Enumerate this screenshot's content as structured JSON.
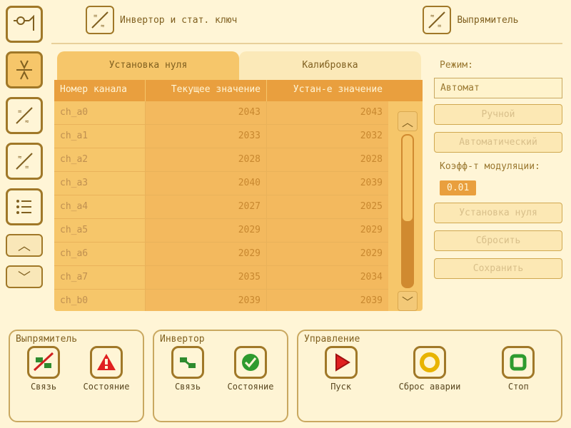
{
  "modes": {
    "inverter": "Инвертор и стат. ключ",
    "rectifier": "Выпрямитель"
  },
  "tabs": {
    "zero": "Установка нуля",
    "calib": "Калибровка"
  },
  "table": {
    "headers": {
      "ch": "Номер канала",
      "cur": "Текущее значение",
      "set": "Устан-е значение"
    },
    "rows": [
      {
        "ch": "ch_a0",
        "cur": "2043",
        "set": "2043"
      },
      {
        "ch": "ch_a1",
        "cur": "2033",
        "set": "2032"
      },
      {
        "ch": "ch_a2",
        "cur": "2028",
        "set": "2028"
      },
      {
        "ch": "ch_a3",
        "cur": "2040",
        "set": "2039"
      },
      {
        "ch": "ch_a4",
        "cur": "2027",
        "set": "2025"
      },
      {
        "ch": "ch_a5",
        "cur": "2029",
        "set": "2029"
      },
      {
        "ch": "ch_a6",
        "cur": "2029",
        "set": "2029"
      },
      {
        "ch": "ch_a7",
        "cur": "2035",
        "set": "2034"
      },
      {
        "ch": "ch_b0",
        "cur": "2039",
        "set": "2039"
      }
    ]
  },
  "right": {
    "mode_label": "Режим:",
    "mode_value": "Автомат",
    "btn_manual": "Ручной",
    "btn_auto": "Автоматический",
    "coef_label": "Коэфф-т модуляции:",
    "coef_value": "0.01",
    "btn_setzero": "Установка нуля",
    "btn_reset": "Сбросить",
    "btn_save": "Сохранить"
  },
  "status": {
    "rect": {
      "title": "Выпрямитель",
      "link": "Связь",
      "state": "Состояние"
    },
    "inv": {
      "title": "Инвертор",
      "link": "Связь",
      "state": "Состояние"
    },
    "ctrl": {
      "title": "Управление",
      "start": "Пуск",
      "reset": "Сброс аварии",
      "stop": "Стоп"
    }
  }
}
